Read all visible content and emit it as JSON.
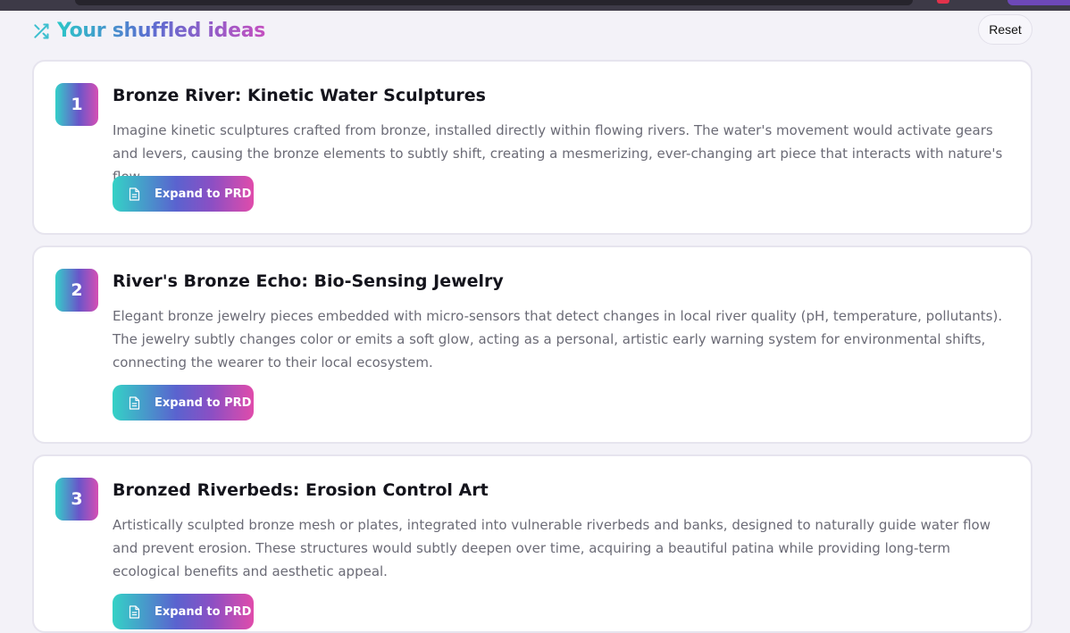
{
  "header": {
    "title": "Your shuffled ideas",
    "reset_label": "Reset"
  },
  "ideas": [
    {
      "number": "1",
      "title": "Bronze River: Kinetic Water Sculptures",
      "description": "Imagine kinetic sculptures crafted from bronze, installed directly within flowing rivers. The water's movement would activate gears and levers, causing the bronze elements to subtly shift, creating a mesmerizing, ever-changing art piece that interacts with nature's flow.",
      "button_label": "Expand to PRD"
    },
    {
      "number": "2",
      "title": "River's Bronze Echo: Bio-Sensing Jewelry",
      "description": "Elegant bronze jewelry pieces embedded with micro-sensors that detect changes in local river quality (pH, temperature, pollutants). The jewelry subtly changes color or emits a soft glow, acting as a personal, artistic early warning system for environmental shifts, connecting the wearer to their local ecosystem.",
      "button_label": "Expand to PRD"
    },
    {
      "number": "3",
      "title": "Bronzed Riverbeds: Erosion Control Art",
      "description": "Artistically sculpted bronze mesh or plates, integrated into vulnerable riverbeds and banks, designed to naturally guide water flow and prevent erosion. These structures would subtly deepen over time, acquiring a beautiful patina while providing long-term ecological benefits and aesthetic appeal.",
      "button_label": "Expand to PRD"
    }
  ],
  "icons": {
    "header": "shuffle-icon",
    "button": "document-icon"
  },
  "colors": {
    "gradient_start": "#34d2c6",
    "gradient_mid": "#5a63cf",
    "gradient_end": "#e04cab",
    "background": "#f3f2f8",
    "card": "#ffffff",
    "text_muted": "#6b6b76"
  }
}
